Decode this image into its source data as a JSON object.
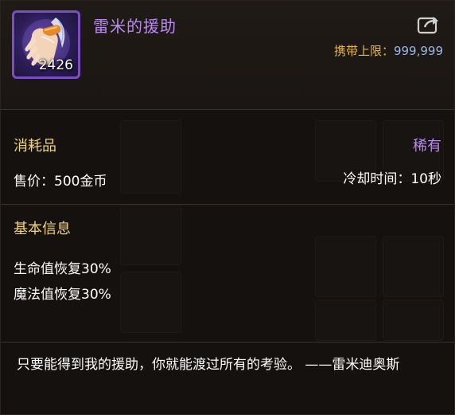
{
  "item": {
    "name": "雷米的援助",
    "count": "2426",
    "icon": "glove-icon",
    "rarity_color": "#b88af2"
  },
  "carry_limit": {
    "label": "携带上限：",
    "value": "999,999"
  },
  "details": {
    "type": "消耗品",
    "rarity": "稀有",
    "price": "售价：500金币",
    "cooldown": "冷却时间：10秒"
  },
  "basic_info": {
    "title": "基本信息",
    "effects": [
      "生命值恢复30%",
      "魔法值恢复30%"
    ]
  },
  "flavor_text": "只要能得到我的援助，你就能渡过所有的考验。 ——雷米迪奥斯",
  "colors": {
    "gold": "#f0d47a",
    "purple": "#b88af2",
    "blue_value": "#9ab8e0"
  }
}
